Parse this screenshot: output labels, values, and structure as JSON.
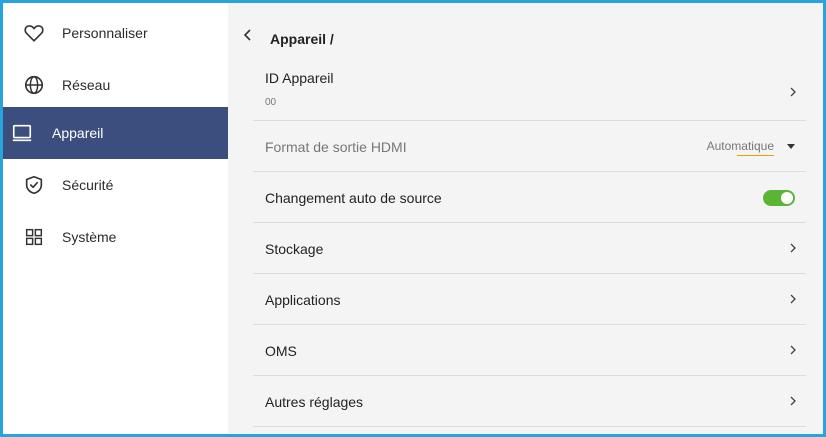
{
  "sidebar": {
    "items": [
      {
        "label": "Personnaliser",
        "icon": "heart-icon",
        "active": false
      },
      {
        "label": "Réseau",
        "icon": "globe-icon",
        "active": false
      },
      {
        "label": "Appareil",
        "icon": "monitor-icon",
        "active": true
      },
      {
        "label": "Sécurité",
        "icon": "shield-icon",
        "active": false
      },
      {
        "label": "Système",
        "icon": "grid-icon",
        "active": false
      }
    ]
  },
  "header": {
    "title": "Appareil /",
    "back_icon": "chevron-left-icon"
  },
  "settings": {
    "device_id": {
      "label": "ID Appareil",
      "value": "00"
    },
    "hdmi_format": {
      "label": "Format de sortie HDMI",
      "value": "Automatique"
    },
    "auto_source": {
      "label": "Changement auto de source",
      "enabled": true
    },
    "storage": {
      "label": "Stockage"
    },
    "applications": {
      "label": "Applications"
    },
    "oms": {
      "label": "OMS"
    },
    "other": {
      "label": "Autres réglages"
    }
  },
  "colors": {
    "accent_border": "#2aa3dc",
    "active_item": "#3b4e7d",
    "toggle_on": "#5ab537",
    "select_underline": "#f0a000"
  }
}
